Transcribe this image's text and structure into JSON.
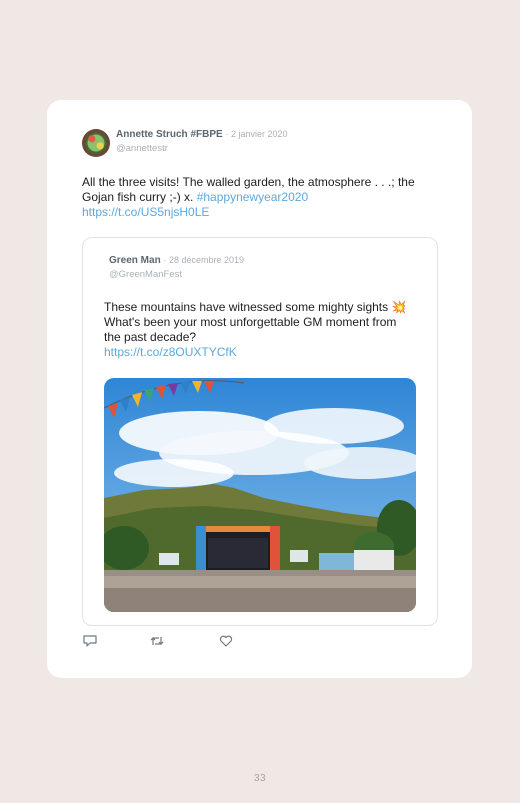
{
  "tweet": {
    "author_name": "Annette Struch #FBPE",
    "date": "2 janvier 2020",
    "handle": "@annettestr",
    "text_main": "All the three visits! The walled garden, the atmosphere . . .; the Gojan fish curry ;-) x. ",
    "hashtag": "#happynewyear2020",
    "link": "https://t.co/US5njsH0LE"
  },
  "quoted_tweet": {
    "author_name": "Green Man",
    "date": "28 décembre 2019",
    "handle": "@GreenManFest",
    "text_before_emoji": "These mountains have witnessed some mighty sights ",
    "emoji": "💥",
    "text_after_emoji": " What's been your most unforgettable GM moment from the past decade?",
    "link": "https://t.co/z8OUXTYCfK"
  },
  "actions": {
    "reply_icon": "reply-icon",
    "retweet_icon": "retweet-icon",
    "like_icon": "heart-icon"
  },
  "page_number": "33",
  "colors": {
    "background": "#efe8e4",
    "card": "#ffffff",
    "link": "#5aa9e0",
    "muted": "#a9b1b7"
  }
}
